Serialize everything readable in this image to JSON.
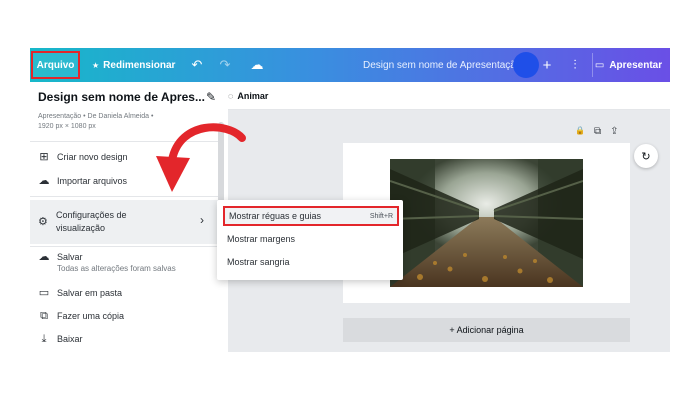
{
  "colors": {
    "accent_red": "#e3262b",
    "gradient_start": "#17b8c9",
    "gradient_end": "#6a4fe6",
    "avatar": "#1f4fe8"
  },
  "topbar": {
    "file_label": "Arquivo",
    "resize_label": "Redimensionar",
    "resize_icon": "★",
    "undo_icon": "↶",
    "redo_icon": "↷",
    "cloud_icon": "☁",
    "doc_title": "Design sem nome de Apresentação",
    "plus_icon": "+",
    "chart_icon": "⫶",
    "present_icon": "▭",
    "present_label": "Apresentar"
  },
  "sidebar": {
    "title": "Design sem nome de Apres...",
    "edit_icon": "✎",
    "meta_line1": "Apresentação • De Daniela Almeida •",
    "meta_line2": "1920 px × 1080 px",
    "items": [
      {
        "icon": "⊞",
        "label": "Criar novo design"
      },
      {
        "icon": "☁",
        "label": "Importar arquivos"
      }
    ],
    "config": {
      "icon": "⚙",
      "line1": "Configurações de",
      "line2": "visualização",
      "chevron": "›"
    },
    "save": {
      "icon": "☁",
      "label": "Salvar",
      "sub": "Todas as alterações foram salvas"
    },
    "bottom_items": [
      {
        "icon": "▭",
        "label": "Salvar em pasta"
      },
      {
        "icon": "⧉",
        "label": "Fazer uma cópia"
      },
      {
        "icon": "⤓",
        "label": "Baixar"
      }
    ]
  },
  "canvas": {
    "animate_icon": "◌",
    "animate_label": "Animar",
    "lock_icon": "🔒",
    "copy_icon": "⧉",
    "share_icon": "⇪",
    "refresh_icon": "↻",
    "add_page_label": "+ Adicionar página"
  },
  "submenu": {
    "items": [
      {
        "label": "Mostrar réguas e guias",
        "shortcut": "Shift+R"
      },
      {
        "label": "Mostrar margens",
        "shortcut": ""
      },
      {
        "label": "Mostrar sangria",
        "shortcut": ""
      }
    ]
  }
}
